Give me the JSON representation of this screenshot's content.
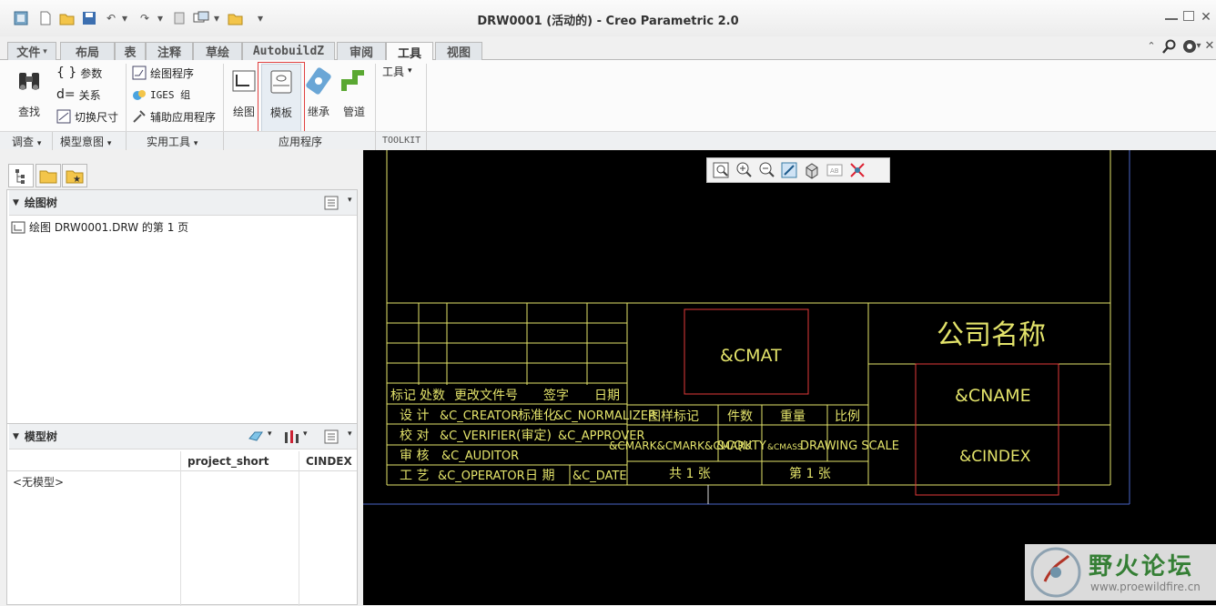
{
  "window": {
    "title": "DRW0001 (活动的) - Creo Parametric 2.0"
  },
  "menu": {
    "file": "文件"
  },
  "tabs": [
    {
      "label": "布局"
    },
    {
      "label": "表"
    },
    {
      "label": "注释"
    },
    {
      "label": "草绘"
    },
    {
      "label": "AutobuildZ"
    },
    {
      "label": "审阅"
    },
    {
      "label": "工具"
    },
    {
      "label": "视图"
    }
  ],
  "ribbon": {
    "find": "查找",
    "params": "参数",
    "relations": "关系",
    "switch_dims": "切换尺寸",
    "drawing_program": "绘图程序",
    "iges": "IGES 组",
    "aux_apps": "辅助应用程序",
    "drawing": "绘图",
    "template": "模板",
    "inherit": "继承",
    "piping": "管道",
    "tools": "工具",
    "groups": {
      "investigate": "调查",
      "model_intent": "模型意图",
      "utilities": "实用工具",
      "applications": "应用程序",
      "toolkit": "TOOLKIT"
    }
  },
  "left": {
    "drawing_tree_title": "绘图树",
    "drawing_tree_item": "绘图 DRW0001.DRW 的第 1 页",
    "model_tree_title": "模型树",
    "columns": [
      "project_short",
      "CINDEX"
    ],
    "empty": "<无模型>"
  },
  "drawing": {
    "company": "公司名称",
    "cname": "&CNAME",
    "cindex": "&CINDEX",
    "cmat": "&CMAT",
    "revision_headers": [
      "标记",
      "处数",
      "更改文件号",
      "签字",
      "日期"
    ],
    "design": "设 计",
    "design_param": "&C_CREATOR",
    "std": "标准化",
    "std_param": "&C_NORMALIZER",
    "verify": "校 对",
    "verify_param": "&C_VERIFIER",
    "approve": "(审定)",
    "approve_param": "&C_APPROVER",
    "audit": "审 核",
    "audit_param": "&C_AUDITOR",
    "process": "工 艺",
    "process_param": "&C_OPERATOR",
    "date": "日 期",
    "date_param": "&C_DATE",
    "sample_mark": "图样标记",
    "qty": "件数",
    "weight": "重量",
    "scale": "比例",
    "mark_params": "&CMARK&CMARK&CMARK",
    "qty_param": "&CQUTY",
    "mass_param": "&CMASS",
    "scale_param": "DRAWING SCALE",
    "total_sheets": "共 1 张",
    "sheet_no": "第 1 张"
  },
  "watermark": {
    "text": "野火论坛",
    "url": "www.proewildfire.cn"
  }
}
